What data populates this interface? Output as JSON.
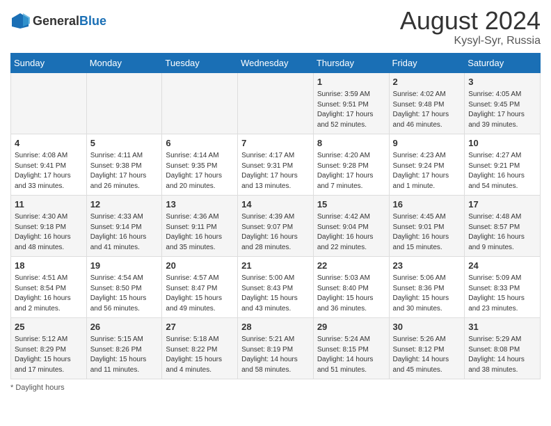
{
  "header": {
    "logo_general": "General",
    "logo_blue": "Blue",
    "month_year": "August 2024",
    "location": "Kysyl-Syr, Russia"
  },
  "days_of_week": [
    "Sunday",
    "Monday",
    "Tuesday",
    "Wednesday",
    "Thursday",
    "Friday",
    "Saturday"
  ],
  "weeks": [
    [
      {
        "day": "",
        "info": ""
      },
      {
        "day": "",
        "info": ""
      },
      {
        "day": "",
        "info": ""
      },
      {
        "day": "",
        "info": ""
      },
      {
        "day": "1",
        "info": "Sunrise: 3:59 AM\nSunset: 9:51 PM\nDaylight: 17 hours and 52 minutes."
      },
      {
        "day": "2",
        "info": "Sunrise: 4:02 AM\nSunset: 9:48 PM\nDaylight: 17 hours and 46 minutes."
      },
      {
        "day": "3",
        "info": "Sunrise: 4:05 AM\nSunset: 9:45 PM\nDaylight: 17 hours and 39 minutes."
      }
    ],
    [
      {
        "day": "4",
        "info": "Sunrise: 4:08 AM\nSunset: 9:41 PM\nDaylight: 17 hours and 33 minutes."
      },
      {
        "day": "5",
        "info": "Sunrise: 4:11 AM\nSunset: 9:38 PM\nDaylight: 17 hours and 26 minutes."
      },
      {
        "day": "6",
        "info": "Sunrise: 4:14 AM\nSunset: 9:35 PM\nDaylight: 17 hours and 20 minutes."
      },
      {
        "day": "7",
        "info": "Sunrise: 4:17 AM\nSunset: 9:31 PM\nDaylight: 17 hours and 13 minutes."
      },
      {
        "day": "8",
        "info": "Sunrise: 4:20 AM\nSunset: 9:28 PM\nDaylight: 17 hours and 7 minutes."
      },
      {
        "day": "9",
        "info": "Sunrise: 4:23 AM\nSunset: 9:24 PM\nDaylight: 17 hours and 1 minute."
      },
      {
        "day": "10",
        "info": "Sunrise: 4:27 AM\nSunset: 9:21 PM\nDaylight: 16 hours and 54 minutes."
      }
    ],
    [
      {
        "day": "11",
        "info": "Sunrise: 4:30 AM\nSunset: 9:18 PM\nDaylight: 16 hours and 48 minutes."
      },
      {
        "day": "12",
        "info": "Sunrise: 4:33 AM\nSunset: 9:14 PM\nDaylight: 16 hours and 41 minutes."
      },
      {
        "day": "13",
        "info": "Sunrise: 4:36 AM\nSunset: 9:11 PM\nDaylight: 16 hours and 35 minutes."
      },
      {
        "day": "14",
        "info": "Sunrise: 4:39 AM\nSunset: 9:07 PM\nDaylight: 16 hours and 28 minutes."
      },
      {
        "day": "15",
        "info": "Sunrise: 4:42 AM\nSunset: 9:04 PM\nDaylight: 16 hours and 22 minutes."
      },
      {
        "day": "16",
        "info": "Sunrise: 4:45 AM\nSunset: 9:01 PM\nDaylight: 16 hours and 15 minutes."
      },
      {
        "day": "17",
        "info": "Sunrise: 4:48 AM\nSunset: 8:57 PM\nDaylight: 16 hours and 9 minutes."
      }
    ],
    [
      {
        "day": "18",
        "info": "Sunrise: 4:51 AM\nSunset: 8:54 PM\nDaylight: 16 hours and 2 minutes."
      },
      {
        "day": "19",
        "info": "Sunrise: 4:54 AM\nSunset: 8:50 PM\nDaylight: 15 hours and 56 minutes."
      },
      {
        "day": "20",
        "info": "Sunrise: 4:57 AM\nSunset: 8:47 PM\nDaylight: 15 hours and 49 minutes."
      },
      {
        "day": "21",
        "info": "Sunrise: 5:00 AM\nSunset: 8:43 PM\nDaylight: 15 hours and 43 minutes."
      },
      {
        "day": "22",
        "info": "Sunrise: 5:03 AM\nSunset: 8:40 PM\nDaylight: 15 hours and 36 minutes."
      },
      {
        "day": "23",
        "info": "Sunrise: 5:06 AM\nSunset: 8:36 PM\nDaylight: 15 hours and 30 minutes."
      },
      {
        "day": "24",
        "info": "Sunrise: 5:09 AM\nSunset: 8:33 PM\nDaylight: 15 hours and 23 minutes."
      }
    ],
    [
      {
        "day": "25",
        "info": "Sunrise: 5:12 AM\nSunset: 8:29 PM\nDaylight: 15 hours and 17 minutes."
      },
      {
        "day": "26",
        "info": "Sunrise: 5:15 AM\nSunset: 8:26 PM\nDaylight: 15 hours and 11 minutes."
      },
      {
        "day": "27",
        "info": "Sunrise: 5:18 AM\nSunset: 8:22 PM\nDaylight: 15 hours and 4 minutes."
      },
      {
        "day": "28",
        "info": "Sunrise: 5:21 AM\nSunset: 8:19 PM\nDaylight: 14 hours and 58 minutes."
      },
      {
        "day": "29",
        "info": "Sunrise: 5:24 AM\nSunset: 8:15 PM\nDaylight: 14 hours and 51 minutes."
      },
      {
        "day": "30",
        "info": "Sunrise: 5:26 AM\nSunset: 8:12 PM\nDaylight: 14 hours and 45 minutes."
      },
      {
        "day": "31",
        "info": "Sunrise: 5:29 AM\nSunset: 8:08 PM\nDaylight: 14 hours and 38 minutes."
      }
    ]
  ],
  "footer": {
    "note": "Daylight hours"
  }
}
